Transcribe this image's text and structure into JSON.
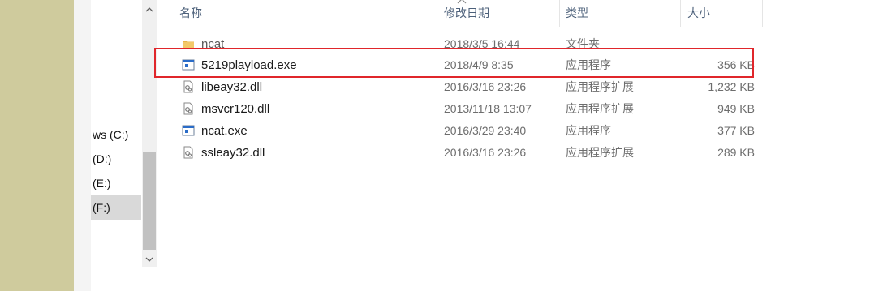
{
  "nav": {
    "items": [
      {
        "label": "ws (C:)",
        "selected": false
      },
      {
        "label": "(D:)",
        "selected": false
      },
      {
        "label": "(E:)",
        "selected": false
      },
      {
        "label": "(F:)",
        "selected": true
      }
    ]
  },
  "columns": {
    "name": "名称",
    "date": "修改日期",
    "type": "类型",
    "size": "大小"
  },
  "files": [
    {
      "name": "ncat",
      "date": "2018/3/5 16:44",
      "type": "文件夹",
      "size": "",
      "icon": "folder-icon"
    },
    {
      "name": "5219playload.exe",
      "date": "2018/4/9 8:35",
      "type": "应用程序",
      "size": "356 KB",
      "icon": "exe-icon"
    },
    {
      "name": "libeay32.dll",
      "date": "2016/3/16 23:26",
      "type": "应用程序扩展",
      "size": "1,232 KB",
      "icon": "dll-icon"
    },
    {
      "name": "msvcr120.dll",
      "date": "2013/11/18 13:07",
      "type": "应用程序扩展",
      "size": "949 KB",
      "icon": "dll-icon"
    },
    {
      "name": "ncat.exe",
      "date": "2016/3/29 23:40",
      "type": "应用程序",
      "size": "377 KB",
      "icon": "exe-icon"
    },
    {
      "name": "ssleay32.dll",
      "date": "2016/3/16 23:26",
      "type": "应用程序扩展",
      "size": "289 KB",
      "icon": "dll-icon"
    }
  ],
  "colors": {
    "highlight": "#e0262b",
    "header_text": "#4c607a",
    "folder": "#e8b64a",
    "exe": "#2a6cc8"
  }
}
